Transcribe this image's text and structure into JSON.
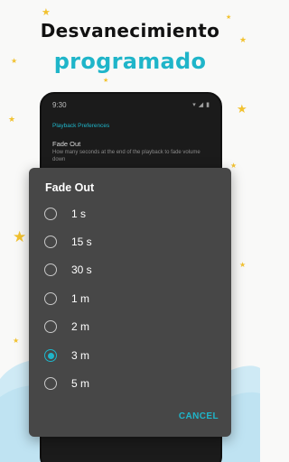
{
  "headline": {
    "line1": "Desvanecimiento",
    "line2": "programado"
  },
  "colors": {
    "accent": "#1fb5c9",
    "star": "#f2c230",
    "cloud": "#bfe3f2",
    "dialog_bg": "#474747",
    "phone_bg": "#1b1b1b"
  },
  "phone": {
    "status_time": "9:30",
    "status_icons": [
      "wifi-icon",
      "signal-icon",
      "battery-icon"
    ],
    "settings": {
      "category": "Playback Preferences",
      "item_title": "Fade Out",
      "item_summary": "How many seconds at the end of the playback to fade volume down"
    }
  },
  "dialog": {
    "title": "Fade Out",
    "options": [
      "1 s",
      "15 s",
      "30 s",
      "1 m",
      "2 m",
      "3 m",
      "5 m"
    ],
    "selected": "3 m",
    "cancel_label": "CANCEL"
  }
}
